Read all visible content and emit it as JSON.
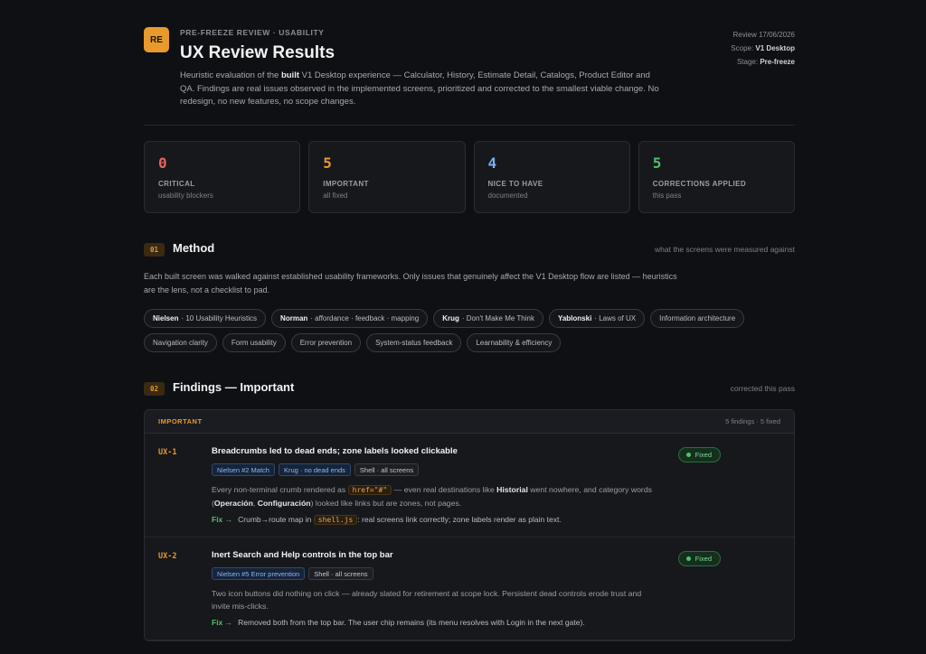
{
  "header": {
    "logo": "RE",
    "kicker": "PRE-FREEZE REVIEW · USABILITY",
    "title": "UX Review Results",
    "intro_pre": "Heuristic evaluation of the ",
    "intro_bold": "built",
    "intro_post": " V1 Desktop experience — Calculator, History, Estimate Detail, Catalogs, Product Editor and QA. Findings are real issues observed in the implemented screens, prioritized and corrected to the smallest viable change. No redesign, no new features, no scope changes.",
    "meta": {
      "review": "Review 17/06/2026",
      "scope_label": "Scope: ",
      "scope_value": "V1 Desktop",
      "stage_label": "Stage: ",
      "stage_value": "Pre-freeze"
    }
  },
  "stats": [
    {
      "value": "0",
      "label": "CRITICAL",
      "sub": "usability blockers",
      "color": "#e0675a"
    },
    {
      "value": "5",
      "label": "IMPORTANT",
      "sub": "all fixed",
      "color": "#e89a2c"
    },
    {
      "value": "4",
      "label": "NICE TO HAVE",
      "sub": "documented",
      "color": "#7ab0ef"
    },
    {
      "value": "5",
      "label": "CORRECTIONS APPLIED",
      "sub": "this pass",
      "color": "#4fc06b"
    }
  ],
  "method": {
    "num": "01",
    "title": "Method",
    "right": "what the screens were measured against",
    "desc": "Each built screen was walked against established usability frameworks. Only issues that genuinely affect the V1 Desktop flow are listed — heuristics are the lens, not a checklist to pad.",
    "chips": [
      {
        "bold": "Nielsen",
        "text": "· 10 Usability Heuristics"
      },
      {
        "bold": "Norman",
        "text": "· affordance · feedback · mapping"
      },
      {
        "bold": "Krug",
        "text": "· Don't Make Me Think"
      },
      {
        "bold": "Yablonski",
        "text": "· Laws of UX"
      },
      {
        "bold": "",
        "text": "Information architecture"
      },
      {
        "bold": "",
        "text": "Navigation clarity"
      },
      {
        "bold": "",
        "text": "Form usability"
      },
      {
        "bold": "",
        "text": "Error prevention"
      },
      {
        "bold": "",
        "text": "System-status feedback"
      },
      {
        "bold": "",
        "text": "Learnability & efficiency"
      }
    ]
  },
  "findings": {
    "num": "02",
    "title": "Findings — Important",
    "right": "corrected this pass",
    "panel_tag": "IMPORTANT",
    "panel_count": "5 findings · 5 fixed",
    "fix_label": "Fix →",
    "items": [
      {
        "id": "UX-1",
        "title": "Breadcrumbs led to dead ends; zone labels looked clickable",
        "status": "Fixed",
        "tags": [
          "Nielsen #2 Match",
          "Krug · no dead ends",
          "Shell · all screens"
        ],
        "desc_1": "Every non-terminal crumb rendered as ",
        "desc_code": "href=\"#\"",
        "desc_2": " — even real destinations like ",
        "desc_b1": "Historial",
        "desc_3": " went nowhere, and category words (",
        "desc_b2": "Operación",
        "desc_4": ", ",
        "desc_b3": "Configuración",
        "desc_5": ") looked like links but are zones, not pages.",
        "fix_1": "Crumb→route map in ",
        "fix_code": "shell.js",
        "fix_2": ": real screens link correctly; zone labels render as plain text."
      },
      {
        "id": "UX-2",
        "title": "Inert Search and Help controls in the top bar",
        "status": "Fixed",
        "tags": [
          "Nielsen #5 Error prevention",
          "Shell · all screens"
        ],
        "desc": "Two icon buttons did nothing on click — already slated for retirement at scope lock. Persistent dead controls erode trust and invite mis-clicks.",
        "fix": "Removed both from the top bar. The user chip remains (its menu resolves with Login in the next gate)."
      }
    ]
  }
}
